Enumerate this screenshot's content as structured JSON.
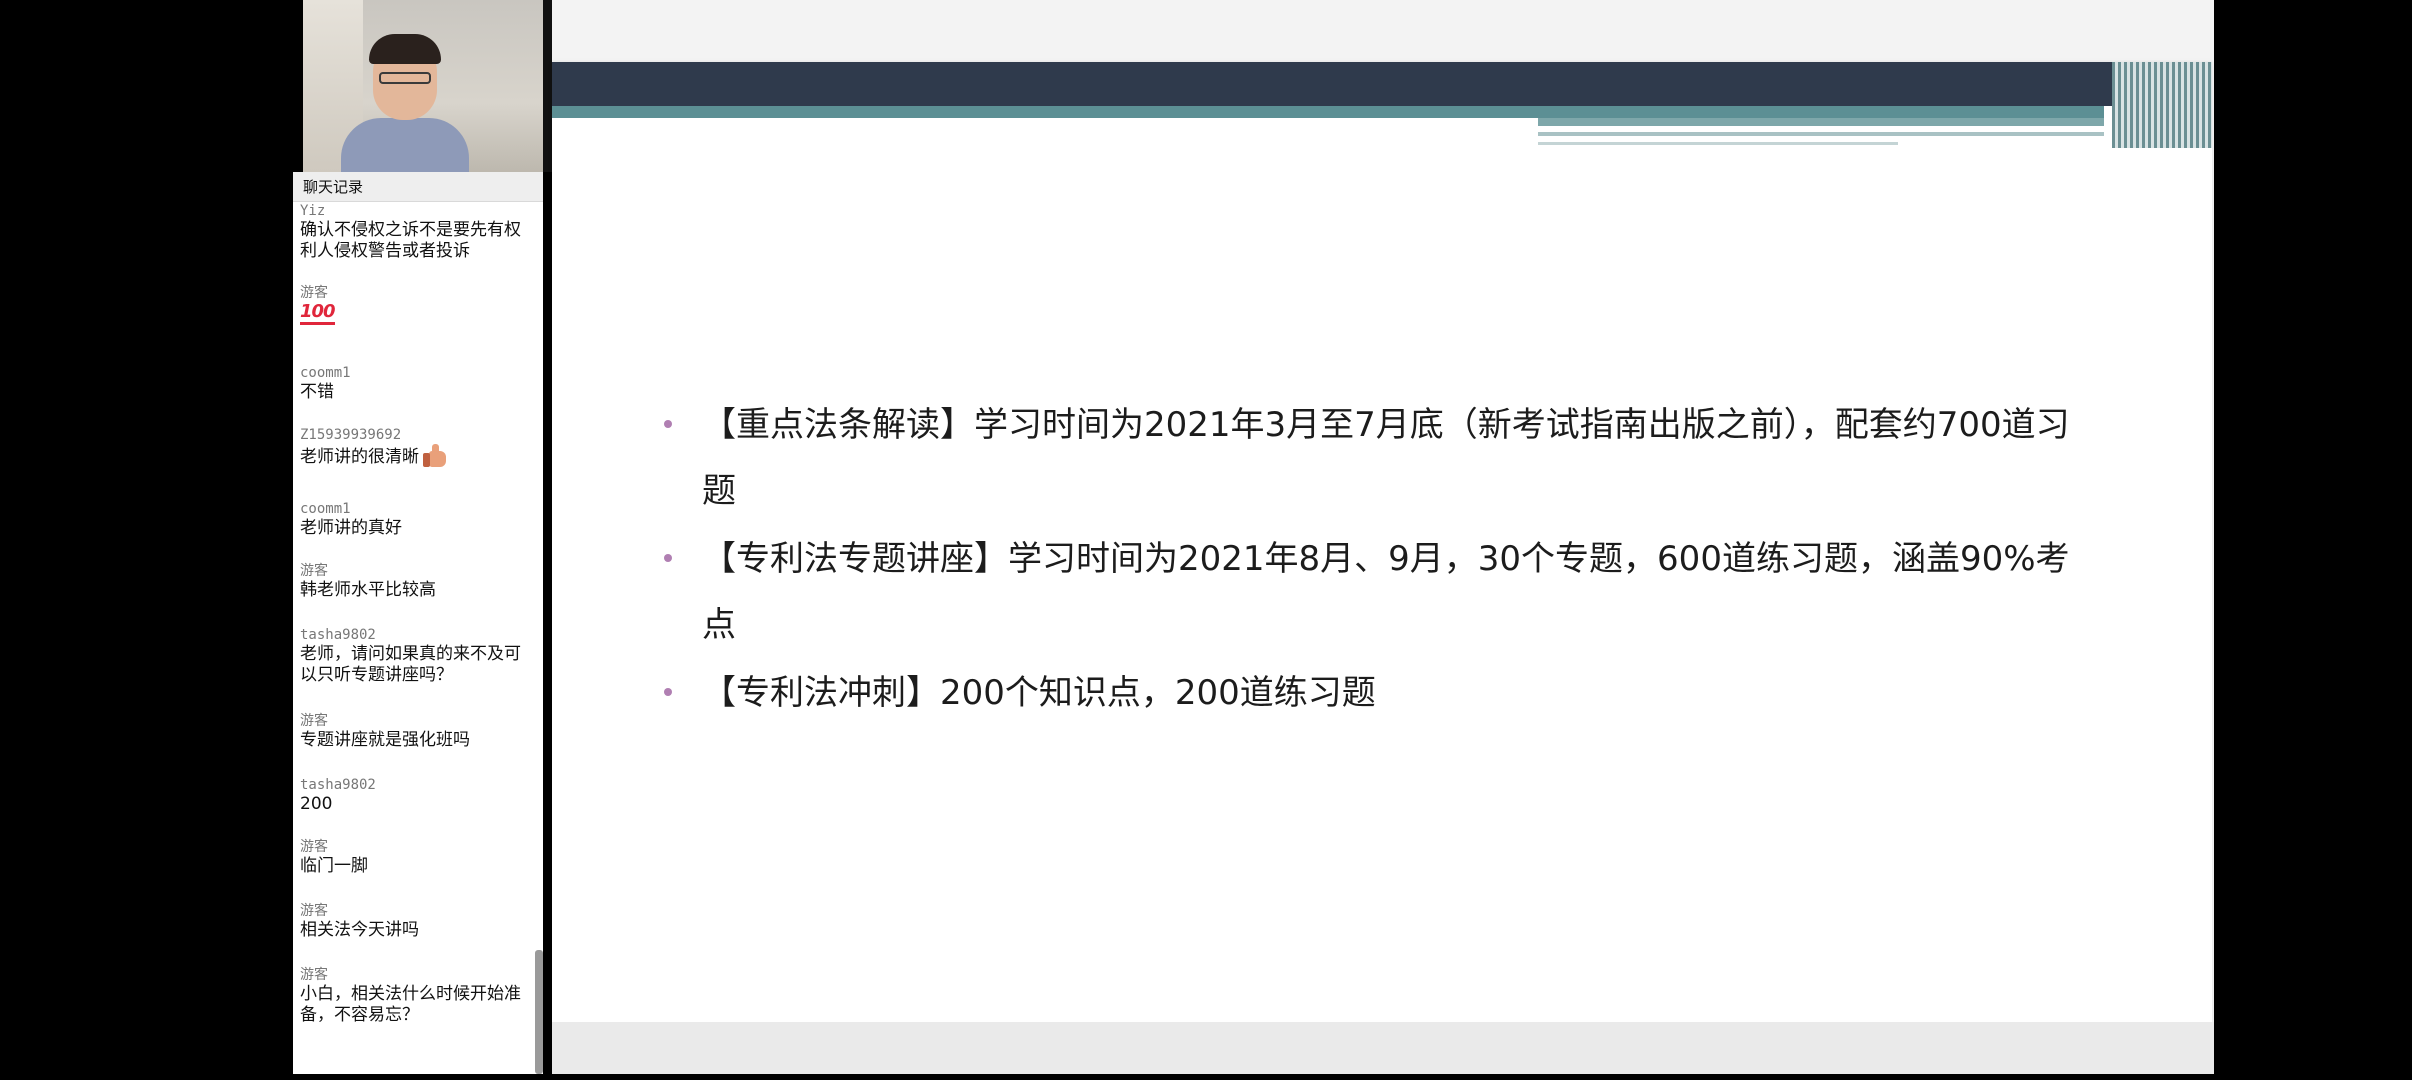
{
  "chat": {
    "title": "聊天记录",
    "messages": [
      {
        "user": "Yiz",
        "text": "确认不侵权之诉不是要先有权利人侵权警告或者投诉"
      },
      {
        "user": "游客",
        "text": "",
        "emoji": "100"
      },
      {
        "user": "coomm1",
        "text": "不错"
      },
      {
        "user": "Z15939939692",
        "text": "老师讲的很清晰",
        "emoji_icon": "thumbs-up-icon"
      },
      {
        "user": "coomm1",
        "text": "老师讲的真好"
      },
      {
        "user": "游客",
        "text": "韩老师水平比较高"
      },
      {
        "user": "tasha9802",
        "text": "老师，请问如果真的来不及可以只听专题讲座吗？"
      },
      {
        "user": "游客",
        "text": "专题讲座就是强化班吗"
      },
      {
        "user": "tasha9802",
        "text": "200"
      },
      {
        "user": "游客",
        "text": "临门一脚"
      },
      {
        "user": "游客",
        "text": "相关法今天讲吗"
      },
      {
        "user": "游客",
        "text": "小白，相关法什么时候开始准备，不容易忘？"
      }
    ]
  },
  "slide": {
    "bullets": [
      "【重点法条解读】学习时间为2021年3月至7月底（新考试指南出版之前），配套约700道习题",
      "【专利法专题讲座】学习时间为2021年8月、9月，30个专题，600道练习题，涵盖90%考点",
      "【专利法冲刺】200个知识点，200道练习题"
    ]
  },
  "colors": {
    "slide_band_dark": "#2f3a4c",
    "slide_band_teal": "#5c8f94",
    "bullet_dot": "#b07fb2"
  }
}
